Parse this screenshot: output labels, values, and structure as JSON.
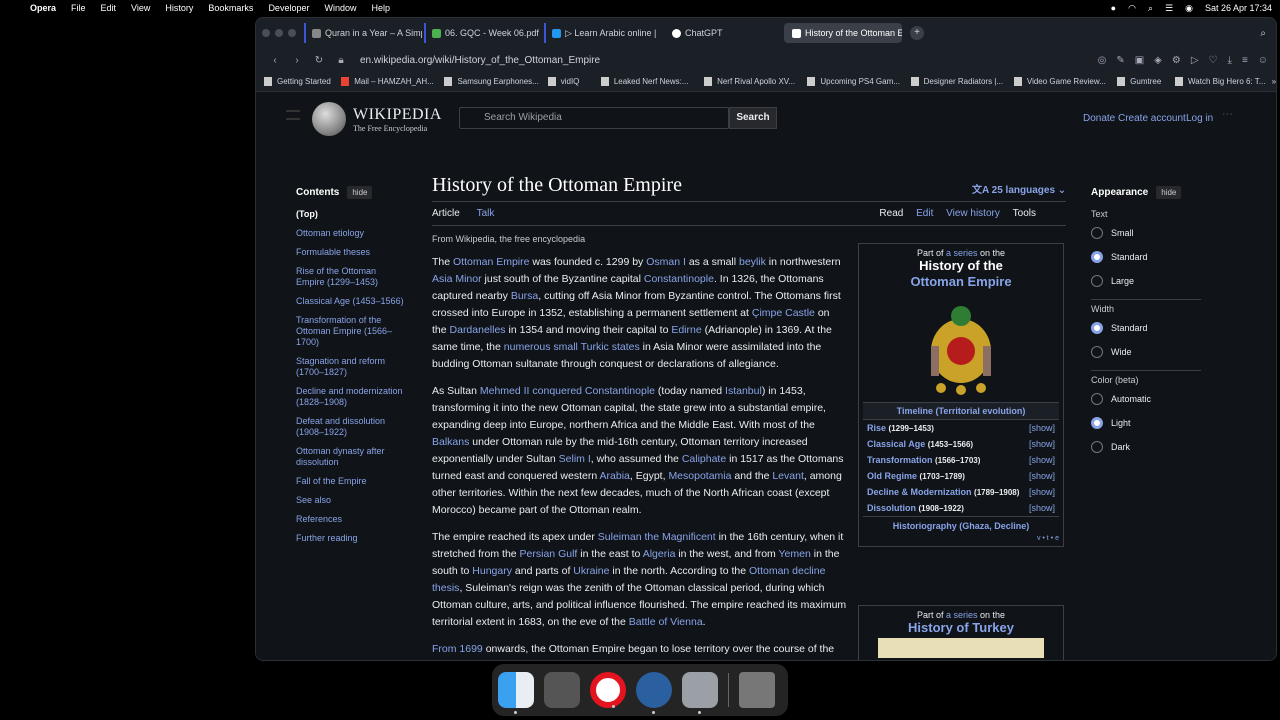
{
  "menubar": {
    "app": "Opera",
    "items": [
      "File",
      "Edit",
      "View",
      "History",
      "Bookmarks",
      "Developer",
      "Window",
      "Help"
    ],
    "datetime": "Sat 26 Apr  17:34"
  },
  "tabs": [
    {
      "label": "Quran in a Year – A Simp"
    },
    {
      "label": "06. GQC - Week 06.pdf"
    },
    {
      "label": "▷ Learn Arabic online | "
    },
    {
      "label": "ChatGPT"
    },
    {
      "label": "History of the Ottoman E"
    }
  ],
  "address": {
    "url": "en.wikipedia.org/wiki/History_of_the_Ottoman_Empire"
  },
  "bookmarks": [
    "Getting Started",
    "Mail – HAMZAH_AH...",
    "Samsung Earphones...",
    "vidIQ",
    "Leaked Nerf News:...",
    "Nerf Rival Apollo XV...",
    "Upcoming PS4 Gam...",
    "Designer Radiators |...",
    "Video Game Review...",
    "Gumtree",
    "Watch Big Hero 6: T..."
  ],
  "wiki": {
    "wordmark": "WIKIPEDIA",
    "tagline": "The Free Encyclopedia",
    "search_placeholder": "Search Wikipedia",
    "search_button": "Search",
    "donate": "Donate",
    "create_account": "Create account",
    "login": "Log in",
    "title": "History of the Ottoman Empire",
    "languages": "25 languages",
    "tab_article": "Article",
    "tab_talk": "Talk",
    "tab_read": "Read",
    "tab_edit": "Edit",
    "tab_history": "View history",
    "tab_tools": "Tools",
    "from": "From Wikipedia, the free encyclopedia"
  },
  "contents": {
    "heading": "Contents",
    "hide": "hide",
    "items": [
      "(Top)",
      "Ottoman etiology",
      "Formulable theses",
      "Rise of the Ottoman Empire (1299–1453)",
      "Classical Age (1453–1566)",
      "Transformation of the Ottoman Empire (1566–1700)",
      "Stagnation and reform (1700–1827)",
      "Decline and modernization (1828–1908)",
      "Defeat and dissolution (1908–1922)",
      "Ottoman dynasty after dissolution",
      "Fall of the Empire",
      "See also",
      "References",
      "Further reading"
    ]
  },
  "infobox": {
    "part_of": "Part of",
    "a_series": "a series",
    "on_the": "on the",
    "title_line1": "History of the",
    "title_line2": "Ottoman Empire",
    "timeline": "Timeline (Territorial evolution)",
    "rows": [
      {
        "name": "Rise",
        "dates": "(1299–1453)",
        "show": "[show]"
      },
      {
        "name": "Classical Age",
        "dates": "(1453–1566)",
        "show": "[show]"
      },
      {
        "name": "Transformation",
        "dates": "(1566–1703)",
        "show": "[show]"
      },
      {
        "name": "Old Regime",
        "dates": "(1703–1789)",
        "show": "[show]"
      },
      {
        "name": "Decline & Modernization",
        "dates": "(1789–1908)",
        "show": "[show]"
      },
      {
        "name": "Dissolution",
        "dates": "(1908–1922)",
        "show": "[show]"
      }
    ],
    "historiography": "Historiography (Ghaza, Decline)",
    "vte": "v • t • e"
  },
  "infobox2": {
    "part_of": "Part of",
    "a_series": "a series",
    "on_the": "on the",
    "title": "History of Turkey"
  },
  "appearance": {
    "heading": "Appearance",
    "hide": "hide",
    "text_label": "Text",
    "text_options": [
      "Small",
      "Standard",
      "Large"
    ],
    "width_label": "Width",
    "width_options": [
      "Standard",
      "Wide"
    ],
    "color_label": "Color (beta)",
    "color_options": [
      "Automatic",
      "Light",
      "Dark"
    ]
  }
}
